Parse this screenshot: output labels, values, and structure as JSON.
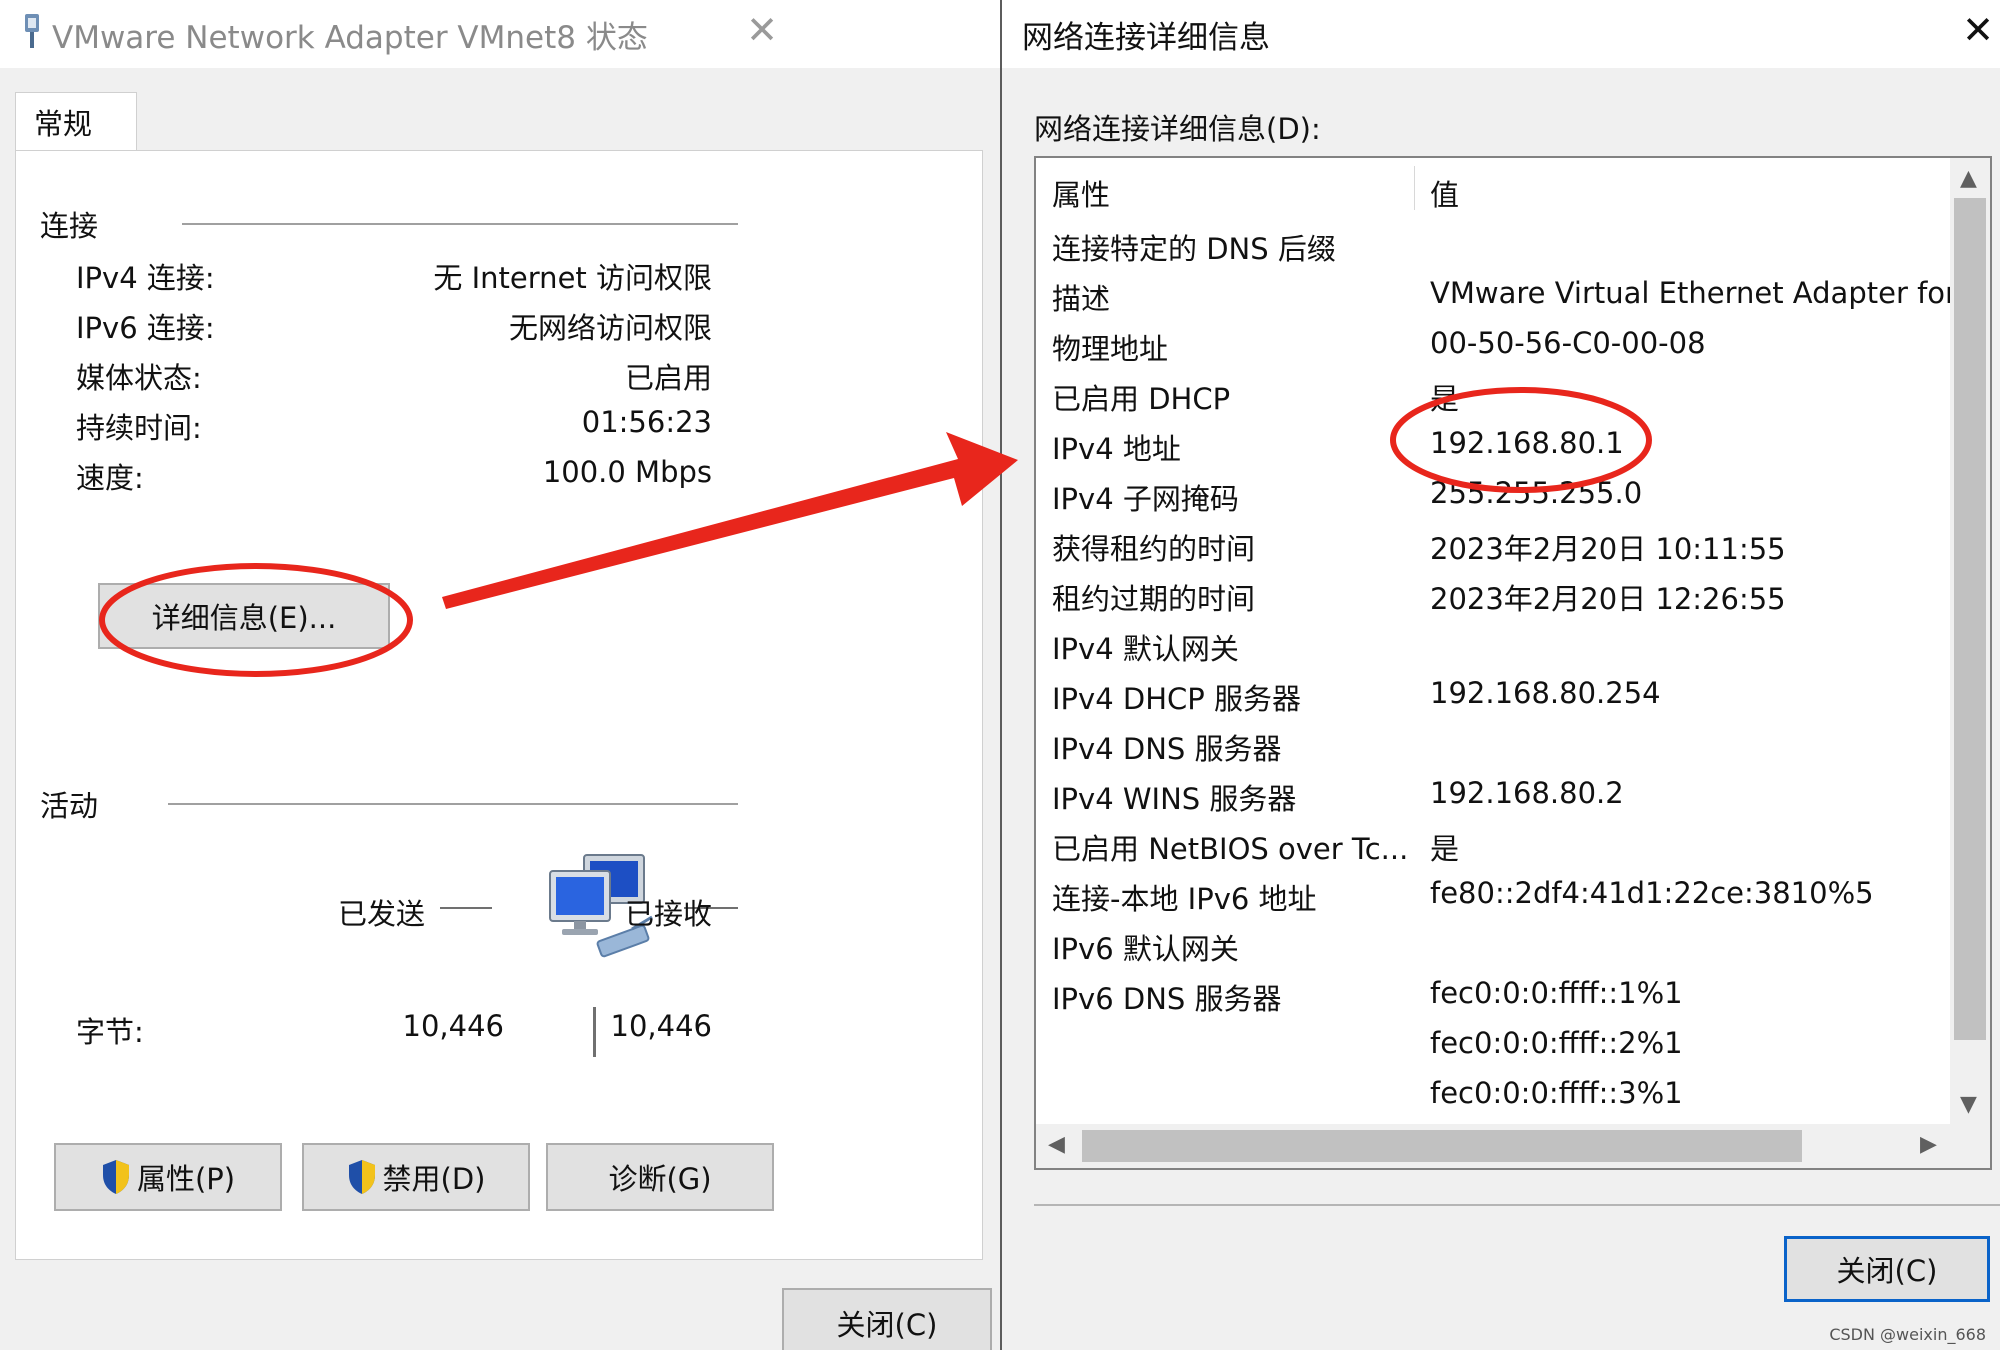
{
  "left_window": {
    "title": "VMware Network Adapter VMnet8 状态",
    "tab": "常规",
    "connection": {
      "group_label": "连接",
      "rows": [
        {
          "label": "IPv4 连接:",
          "value": "无 Internet 访问权限"
        },
        {
          "label": "IPv6 连接:",
          "value": "无网络访问权限"
        },
        {
          "label": "媒体状态:",
          "value": "已启用"
        },
        {
          "label": "持续时间:",
          "value": "01:56:23"
        },
        {
          "label": "速度:",
          "value": "100.0 Mbps"
        }
      ],
      "details_button": "详细信息(E)..."
    },
    "activity": {
      "group_label": "活动",
      "sent_label": "已发送",
      "received_label": "已接收",
      "bytes_label": "字节:",
      "bytes_sent": "10,446",
      "bytes_received": "10,446"
    },
    "buttons": {
      "properties": "属性(P)",
      "disable": "禁用(D)",
      "diagnose": "诊断(G)",
      "close": "关闭(C)"
    }
  },
  "right_window": {
    "title": "网络连接详细信息",
    "list_label": "网络连接详细信息(D):",
    "columns": {
      "property": "属性",
      "value": "值"
    },
    "rows": [
      {
        "property": "连接特定的 DNS 后缀",
        "value": ""
      },
      {
        "property": "描述",
        "value": "VMware Virtual Ethernet Adapter for"
      },
      {
        "property": "物理地址",
        "value": "00-50-56-C0-00-08"
      },
      {
        "property": "已启用 DHCP",
        "value": "是"
      },
      {
        "property": "IPv4 地址",
        "value": "192.168.80.1"
      },
      {
        "property": "IPv4 子网掩码",
        "value": "255.255.255.0"
      },
      {
        "property": "获得租约的时间",
        "value": "2023年2月20日 10:11:55"
      },
      {
        "property": "租约过期的时间",
        "value": "2023年2月20日 12:26:55"
      },
      {
        "property": "IPv4 默认网关",
        "value": ""
      },
      {
        "property": "IPv4 DHCP 服务器",
        "value": "192.168.80.254"
      },
      {
        "property": "IPv4 DNS 服务器",
        "value": ""
      },
      {
        "property": "IPv4 WINS 服务器",
        "value": "192.168.80.2"
      },
      {
        "property": "已启用 NetBIOS over Tc...",
        "value": "是"
      },
      {
        "property": "连接-本地 IPv6 地址",
        "value": "fe80::2df4:41d1:22ce:3810%5"
      },
      {
        "property": "IPv6 默认网关",
        "value": ""
      },
      {
        "property": "IPv6 DNS 服务器",
        "value": "fec0:0:0:ffff::1%1"
      },
      {
        "property": "",
        "value": "fec0:0:0:ffff::2%1"
      },
      {
        "property": "",
        "value": "fec0:0:0:ffff::3%1"
      }
    ],
    "close_button": "关闭(C)"
  },
  "icons": {
    "window_icon": "network-adapter-icon",
    "close": "close-icon",
    "shield": "uac-shield-icon",
    "computers": "network-computers-icon",
    "scroll_up": "chevron-up-icon",
    "scroll_down": "chevron-down-icon",
    "scroll_left": "chevron-left-icon",
    "scroll_right": "chevron-right-icon"
  },
  "annotation_color": "#e8261c",
  "watermark": "CSDN @weixin_668"
}
